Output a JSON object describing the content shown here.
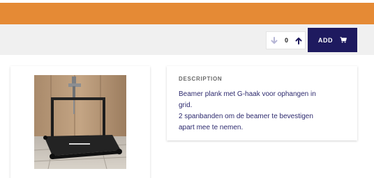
{
  "header": {
    "accent_color": "#e58a35"
  },
  "cart_actions": {
    "quantity": "0",
    "decrease_icon": "arrow-down-icon",
    "increase_icon": "arrow-up-icon",
    "add_label": "ADD",
    "cart_icon": "cart-icon",
    "button_color": "#1e1a5f"
  },
  "product": {
    "image_alt": "Beamer plank"
  },
  "description": {
    "title": "DESCRIPTION",
    "lines": [
      "Beamer plank met G-haak voor ophangen in",
      "grid.",
      "2 spanbanden om de beamer te bevestigen",
      "apart mee te nemen."
    ]
  }
}
